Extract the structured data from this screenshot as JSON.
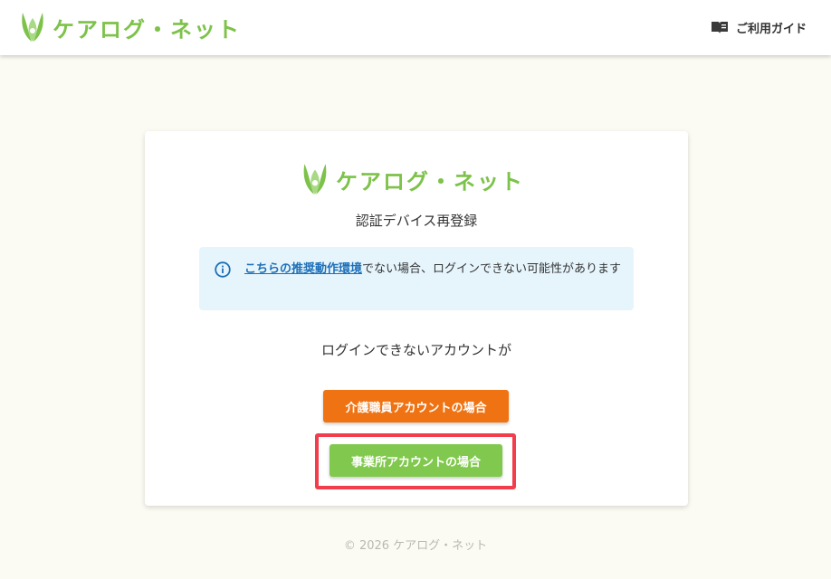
{
  "header": {
    "logo_text": "ケアログ・ネット",
    "guide_label": "ご利用ガイド"
  },
  "card": {
    "logo_text": "ケアログ・ネット",
    "title": "認証デバイス再登録",
    "alert": {
      "link_text": "こちらの推奨動作環境",
      "text": "でない場合、ログインできない可能性があります"
    },
    "prompt": "ログインできないアカウントが",
    "buttons": {
      "staff": "介護職員アカウントの場合",
      "office": "事業所アカウントの場合"
    }
  },
  "footer": {
    "copyright": "© 2026 ケアログ・ネット"
  },
  "colors": {
    "brand_green": "#7dc24a",
    "orange_button": "#ef7313",
    "green_button": "#81c94e",
    "highlight_red": "#f23d4d",
    "alert_bg": "#e6f5fc",
    "link_blue": "#1d6fb8",
    "page_bg": "#fcfbf3"
  },
  "icons": {
    "logo": "leaf-logo-icon",
    "guide": "book-icon",
    "alert": "info-circle-icon"
  }
}
